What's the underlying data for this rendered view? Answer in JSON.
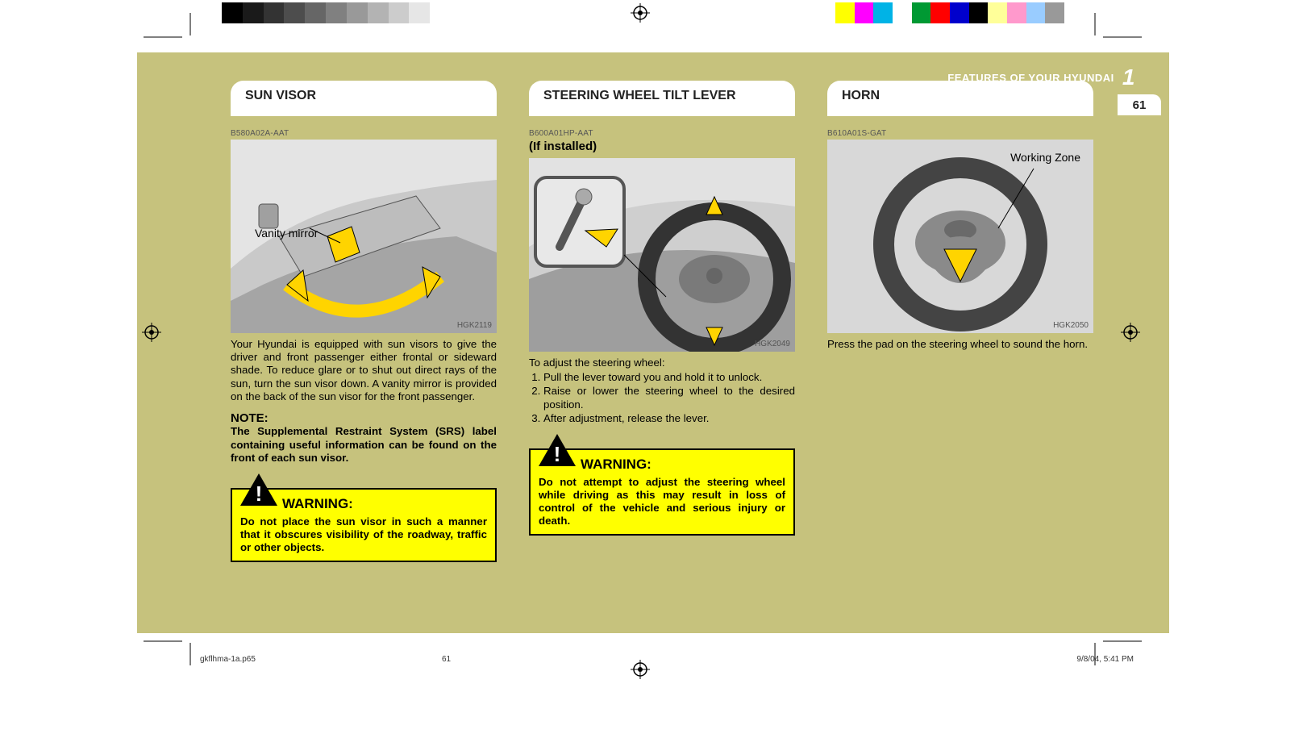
{
  "header": {
    "section_label": "FEATURES OF YOUR HYUNDAI",
    "chapter_number": "1",
    "page_number": "61"
  },
  "columns": {
    "sun_visor": {
      "tab": "SUN VISOR",
      "part_code": "B580A02A-AAT",
      "illus_label": "Vanity mirror",
      "fig_id": "HGK2119",
      "body": "Your Hyundai is equipped with sun visors to give the driver and front passenger either frontal or sideward shade. To reduce glare or to shut out direct rays of the sun, turn the sun visor down. A vanity mirror is provided on the back of the sun visor for the front passenger.",
      "note_title": "NOTE:",
      "note_body": "The Supplemental Restraint System (SRS) label containing useful information can be found on the front of each sun visor.",
      "warning_title": "WARNING:",
      "warning_text": "Do not place the sun visor in such a manner that it obscures visibility of the roadway, traffic or other objects."
    },
    "tilt_lever": {
      "tab": "STEERING WHEEL TILT LEVER",
      "part_code": "B600A01HP-AAT",
      "subhead": "(If installed)",
      "fig_id": "HGK2049",
      "steps_intro": "To adjust the steering wheel:",
      "steps": [
        "Pull the lever toward you and hold it to unlock.",
        "Raise or lower the steering wheel to the desired position.",
        "After adjustment, release the lever."
      ],
      "warning_title": "WARNING:",
      "warning_text": "Do not attempt to adjust the steering wheel while driving as this may result in loss of control of the vehicle and serious injury or death."
    },
    "horn": {
      "tab": "HORN",
      "part_code": "B610A01S-GAT",
      "illus_label": "Working Zone",
      "fig_id": "HGK2050",
      "body": "Press the pad on the steering wheel to sound the horn."
    }
  },
  "footer": {
    "filename": "gkflhma-1a.p65",
    "page": "61",
    "datetime": "9/8/04, 5:41 PM"
  },
  "print_bars": {
    "left": [
      "#000000",
      "#1a1a1a",
      "#333333",
      "#4d4d4d",
      "#666666",
      "#808080",
      "#999999",
      "#b3b3b3",
      "#cccccc",
      "#e6e6e6",
      "#ffffff"
    ],
    "right": [
      "#ffff00",
      "#ff00ff",
      "#00b3e6",
      "#ffffff",
      "#009933",
      "#ff0000",
      "#0000cc",
      "#000000",
      "#ffff99",
      "#ff99cc",
      "#99ccff",
      "#999999"
    ]
  }
}
